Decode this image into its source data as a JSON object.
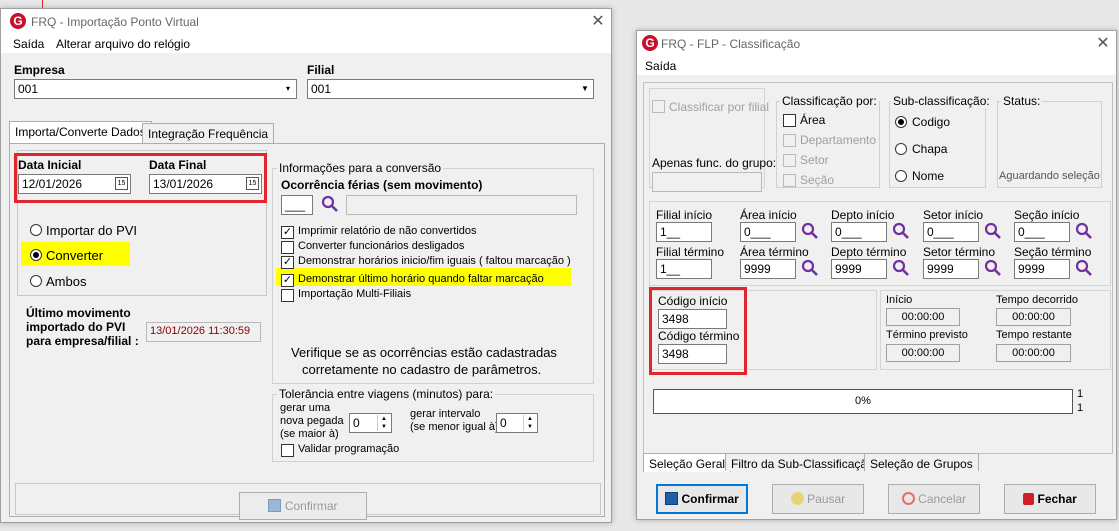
{
  "win1": {
    "title": "FRQ - Importação Ponto Virtual",
    "logo": "G",
    "menu": [
      "Saída",
      "Alterar arquivo do relógio"
    ],
    "empresa_label": "Empresa",
    "empresa_value": "001",
    "filial_label": "Filial",
    "filial_value": "001",
    "tabs": [
      "Importa/Converte Dados",
      "Integração Frequência"
    ],
    "data_inicial_label": "Data Inicial",
    "data_inicial_value": "12/01/2026",
    "data_final_label": "Data Final",
    "data_final_value": "13/01/2026",
    "date_icon": "15",
    "radios": [
      "Importar do PVI",
      "Converter",
      "Ambos"
    ],
    "ultimo_label": [
      "Último movimento",
      "importado do PVI",
      "para empresa/filial :"
    ],
    "ultimo_value": "13/01/2026  11:30:59",
    "info_group": "Informações para a conversão",
    "ocorrencia_label": "Ocorrência férias (sem movimento)",
    "ocorrencia_value": "___",
    "checks": [
      "Imprimir relatório de não convertidos",
      "Converter funcionários desligados",
      "Demonstrar horários inicio/fim iguais ( faltou marcação )",
      "Demonstrar último horário quando faltar marcação",
      "Importação Multi-Filiais"
    ],
    "checks_state": [
      true,
      false,
      true,
      true,
      false
    ],
    "verify_text": [
      "Verifique se as ocorrências estão cadastradas",
      "corretamente  no cadastro de parâmetros."
    ],
    "tol_group": "Tolerância entre viagens (minutos) para:",
    "gerar_pegada": [
      "gerar uma",
      "nova pegada",
      "(se maior à)"
    ],
    "gerar_pegada_value": "0",
    "gerar_intervalo": [
      "gerar intervalo",
      "(se menor igual à)"
    ],
    "gerar_intervalo_value": "0",
    "validar": "Validar programação",
    "confirmar": "Confirmar",
    "close": "✕"
  },
  "win2": {
    "title": "FRQ - FLP - Classificação",
    "logo": "G",
    "menu": [
      "Saída"
    ],
    "classificar_filial": "Classificar por filial",
    "classif_group": "Classificação  por:",
    "classif_items": [
      "Área",
      "Departamento",
      "Setor",
      "Seção"
    ],
    "subclass_group": "Sub-classificação:",
    "subclass_items": [
      "Codigo",
      "Chapa",
      "Nome"
    ],
    "status_group": "Status:",
    "status_value": "Aguardando seleção",
    "apenas_label": "Apenas func. do grupo:",
    "filtros": [
      {
        "ini_label": "Filial início",
        "ini_value": "1__",
        "fim_label": "Filial término",
        "fim_value": "1__"
      },
      {
        "ini_label": "Área início",
        "ini_value": "0___",
        "fim_label": "Área término",
        "fim_value": "9999"
      },
      {
        "ini_label": "Depto início",
        "ini_value": "0___",
        "fim_label": "Depto término",
        "fim_value": "9999"
      },
      {
        "ini_label": "Setor início",
        "ini_value": "0___",
        "fim_label": "Setor término",
        "fim_value": "9999"
      },
      {
        "ini_label": "Seção início",
        "ini_value": "0___",
        "fim_label": "Seção término",
        "fim_value": "9999"
      }
    ],
    "codigo_inicio_label": "Código início",
    "codigo_inicio_value": "3498",
    "codigo_termino_label": "Código término",
    "codigo_termino_value": "3498",
    "inicio_label": "Início",
    "inicio_value": "00:00:00",
    "tempo_decorrido_label": "Tempo decorrido",
    "tempo_decorrido_value": "00:00:00",
    "termino_previsto_label": "Término previsto",
    "termino_previsto_value": "00:00:00",
    "tempo_restante_label": "Tempo restante",
    "tempo_restante_value": "00:00:00",
    "progress_text": "0%",
    "progress_fraction": 0,
    "counter_top": "1",
    "counter_bottom": "1",
    "tabs": [
      "Seleção Geral",
      "Filtro da Sub-Classificação",
      "Seleção de Grupos"
    ],
    "buttons": [
      "Confirmar",
      "Pausar",
      "Cancelar",
      "Fechar"
    ],
    "close": "✕"
  },
  "colors": {
    "highlight": "#ffff00",
    "annotation_red": "#e0262c",
    "search_icon": "#7030a0",
    "logo": "#c8102e",
    "dark_red_text": "#8b0000"
  }
}
